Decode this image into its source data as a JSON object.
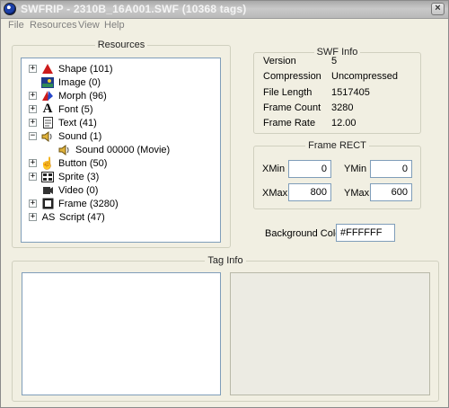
{
  "window": {
    "title": "SWFRIP - 2310B_16A001.SWF (10368 tags)"
  },
  "menu": [
    "File",
    "Resources",
    "View",
    "Help"
  ],
  "resources": {
    "legend": "Resources",
    "items": [
      {
        "label": "Shape (101)",
        "icon": "shape-icon",
        "expander": "+"
      },
      {
        "label": "Image (0)",
        "icon": "image-icon",
        "expander": ""
      },
      {
        "label": "Morph (96)",
        "icon": "morph-icon",
        "expander": "+"
      },
      {
        "label": "Font (5)",
        "icon": "font-icon",
        "expander": "+"
      },
      {
        "label": "Text (41)",
        "icon": "text-icon",
        "expander": "+"
      },
      {
        "label": "Sound (1)",
        "icon": "sound-icon",
        "expander": "−"
      },
      {
        "label": "Sound 00000  (Movie)",
        "icon": "sound-icon",
        "expander": ""
      },
      {
        "label": "Button (50)",
        "icon": "button-icon",
        "expander": "+"
      },
      {
        "label": "Sprite (3)",
        "icon": "sprite-icon",
        "expander": "+"
      },
      {
        "label": "Video (0)",
        "icon": "video-icon",
        "expander": ""
      },
      {
        "label": "Frame (3280)",
        "icon": "frame-icon",
        "expander": "+"
      },
      {
        "label": "Script (47)",
        "icon": "script-icon",
        "expander": "+",
        "icon_text": "AS"
      }
    ]
  },
  "swf_info": {
    "legend": "SWF Info",
    "rows": [
      {
        "label": "Version",
        "value": "5"
      },
      {
        "label": "Compression",
        "value": "Uncompressed"
      },
      {
        "label": "File Length",
        "value": "1517405"
      },
      {
        "label": "Frame Count",
        "value": "3280"
      },
      {
        "label": "Frame Rate",
        "value": "12.00"
      }
    ]
  },
  "frame_rect": {
    "legend": "Frame RECT",
    "xmin_label": "XMin",
    "xmin": "0",
    "ymin_label": "YMin",
    "ymin": "0",
    "xmax_label": "XMax",
    "xmax": "800",
    "ymax_label": "YMax",
    "ymax": "600"
  },
  "background": {
    "label": "Background Color",
    "value": "#FFFFFF"
  },
  "tag_info": {
    "legend": "Tag Info"
  }
}
